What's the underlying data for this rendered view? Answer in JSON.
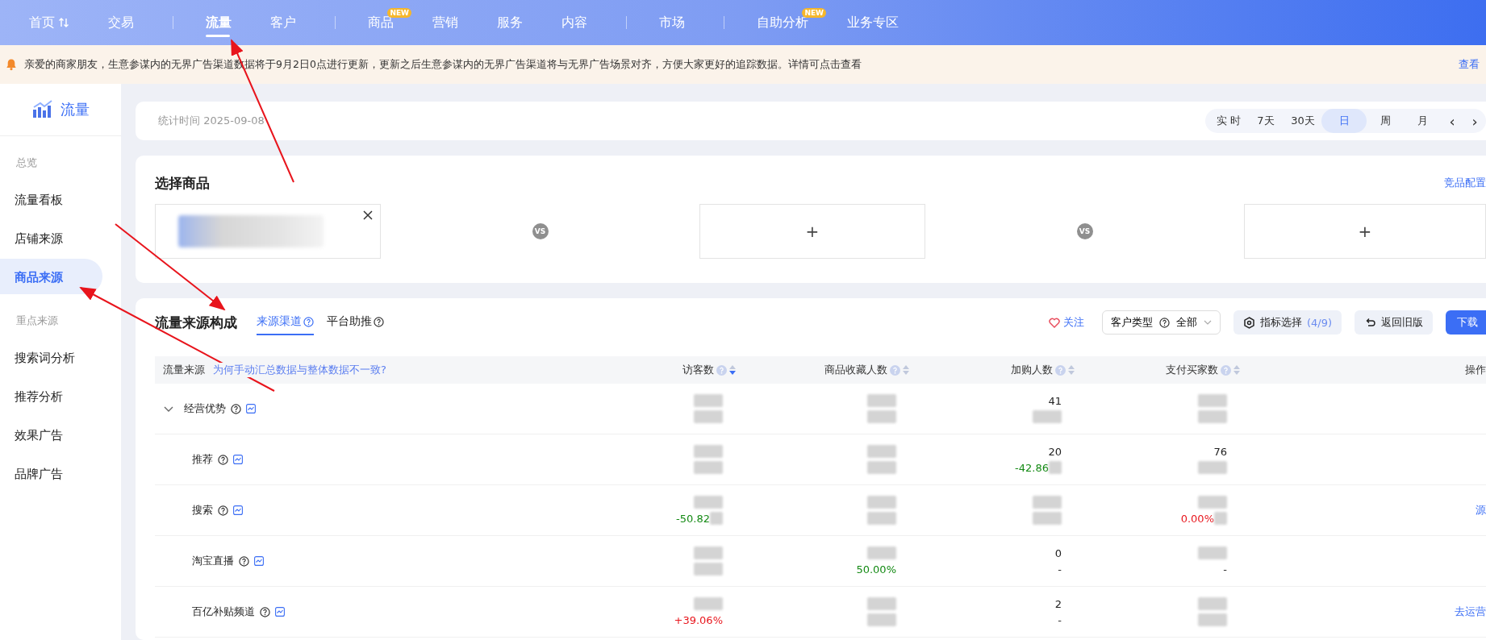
{
  "nav": {
    "items": [
      {
        "kind": "link",
        "label": "首页",
        "selected": false,
        "switch": true
      },
      {
        "kind": "link",
        "label": "交易",
        "selected": false
      },
      {
        "kind": "divider"
      },
      {
        "kind": "link",
        "label": "流量",
        "selected": true
      },
      {
        "kind": "link",
        "label": "客户",
        "selected": false
      },
      {
        "kind": "divider"
      },
      {
        "kind": "link",
        "label": "商品",
        "selected": false,
        "badge": "NEW"
      },
      {
        "kind": "link",
        "label": "营销",
        "selected": false
      },
      {
        "kind": "link",
        "label": "服务",
        "selected": false
      },
      {
        "kind": "link",
        "label": "内容",
        "selected": false
      },
      {
        "kind": "divider"
      },
      {
        "kind": "link",
        "label": "市场",
        "selected": false
      },
      {
        "kind": "divider"
      },
      {
        "kind": "link",
        "label": "自助分析",
        "selected": false,
        "badge": "NEW"
      },
      {
        "kind": "link",
        "label": "业务专区",
        "selected": false
      }
    ]
  },
  "notice": {
    "text": "亲爱的商家朋友，生意参谋内的无界广告渠道数据将于9月2日0点进行更新，更新之后生意参谋内的无界广告渠道将与无界广告场景对齐，方便大家更好的追踪数据。详情可点击查看",
    "link": "查看"
  },
  "sidebar": {
    "title": "流量",
    "groups": [
      {
        "label": "总览",
        "items": [
          {
            "label": "流量看板",
            "selected": false
          },
          {
            "label": "店铺来源",
            "selected": false
          },
          {
            "label": "商品来源",
            "selected": true
          }
        ]
      },
      {
        "label": "重点来源",
        "items": [
          {
            "label": "搜索词分析",
            "selected": false
          },
          {
            "label": "推荐分析",
            "selected": false
          },
          {
            "label": "效果广告",
            "selected": false
          },
          {
            "label": "品牌广告",
            "selected": false
          }
        ]
      }
    ]
  },
  "stats_bar": {
    "label": "统计时间 2025-09-08",
    "periods": [
      {
        "label": "实 时",
        "selected": false
      },
      {
        "label": "7天",
        "selected": false
      },
      {
        "label": "30天",
        "selected": false
      },
      {
        "label": "日",
        "selected": true
      },
      {
        "label": "周",
        "selected": false
      },
      {
        "label": "月",
        "selected": false
      }
    ],
    "prev": "‹",
    "next": "›"
  },
  "product_select": {
    "title": "选择商品",
    "link": "竞品配置",
    "slots": [
      {
        "kind": "product"
      },
      {
        "kind": "empty",
        "label": "+",
        "vs": "VS"
      },
      {
        "kind": "empty",
        "label": "+",
        "vs": "VS"
      }
    ]
  },
  "traffic": {
    "title": "流量来源构成",
    "tabs": [
      {
        "label": "来源渠道",
        "selected": true
      },
      {
        "label": "平台助推",
        "selected": false
      }
    ],
    "follow": "关注",
    "customer_type": {
      "label": "客户类型",
      "value": "全部"
    },
    "metrics_button": {
      "label": "指标选择",
      "count": "(4/9)"
    },
    "old_version_button": "返回旧版",
    "download_button": "下载",
    "table": {
      "source_label": "流量来源",
      "help_link": "为何手动汇总数据与整体数据不一致?",
      "columns": [
        {
          "label": "访客数",
          "sorted": true
        },
        {
          "label": "商品收藏人数",
          "sorted": false
        },
        {
          "label": "加购人数",
          "sorted": false
        },
        {
          "label": "支付买家数",
          "sorted": false
        }
      ],
      "action_column": "操作",
      "rows": [
        {
          "name": "经营优势",
          "expanded": true,
          "cells": [
            {},
            {},
            {
              "value": "41"
            },
            {}
          ],
          "children": [
            {
              "name": "推荐",
              "cells": [
                {},
                {},
                {
                  "value": "20",
                  "change": "-42.86",
                  "partial": true,
                  "color": "#148a14"
                },
                {
                  "value": "76"
                }
              ]
            },
            {
              "name": "搜索",
              "cells": [
                {
                  "change": "-50.82",
                  "partial": true,
                  "color": "#148a14"
                },
                {},
                {},
                {
                  "change": "0.00%",
                  "partial": true,
                  "color": "#e8171e"
                }
              ],
              "action": "源"
            },
            {
              "name": "淘宝直播",
              "cells": [
                {},
                {
                  "change": "50.00%",
                  "color": "#148a14"
                },
                {
                  "value": "0",
                  "change": "-",
                  "color": "#333333"
                },
                {
                  "change": "-",
                  "color": "#333333"
                }
              ]
            },
            {
              "name": "百亿补贴频道",
              "cells": [
                {
                  "change": "+39.06%",
                  "color": "#e8171e"
                },
                {},
                {
                  "value": "2",
                  "change": "-",
                  "color": "#333333"
                },
                {}
              ],
              "action": "去运营"
            }
          ]
        }
      ]
    }
  }
}
